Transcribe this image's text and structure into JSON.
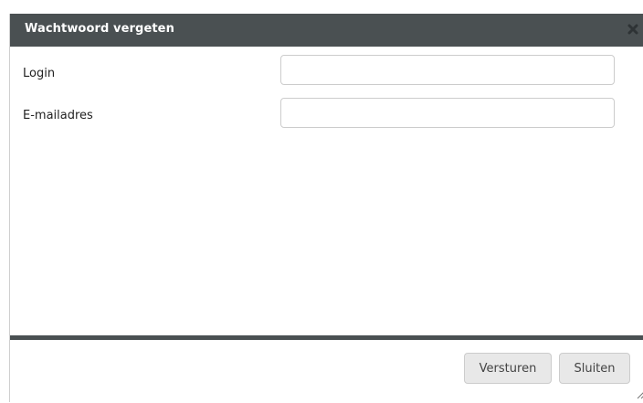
{
  "dialog": {
    "title": "Wachtwoord vergeten",
    "close_icon": "close-icon",
    "accent_color": "#4a5052"
  },
  "form": {
    "login": {
      "label": "Login",
      "value": "",
      "placeholder": ""
    },
    "email": {
      "label": "E-mailadres",
      "value": "",
      "placeholder": ""
    }
  },
  "footer": {
    "send_label": "Versturen",
    "close_label": "Sluiten"
  }
}
